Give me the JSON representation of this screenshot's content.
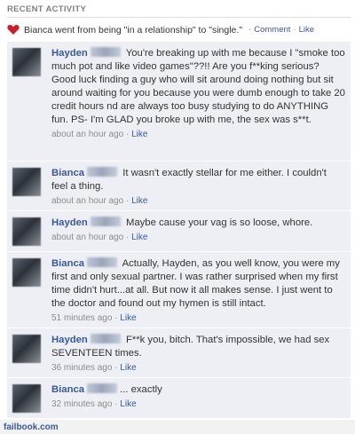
{
  "header": {
    "title": "RECENT ACTIVITY"
  },
  "story": {
    "text": "Bianca went from being \"in a relationship\" to \"single.\"",
    "comment_link": "Comment",
    "like_link": "Like",
    "separator": "·"
  },
  "comments": [
    {
      "author": "Hayden",
      "text": "You're breaking up with me because I \"smoke too much pot and like video games\"??!! Are you f**king serious? Good luck finding a guy who will sit around doing nothing but sit around waiting for you because you were dumb enough to take 20 credit hours nd are always too busy studying to do ANYTHING fun. PS- I'm GLAD you broke up with me, the sex was s**t.",
      "time": "about an hour ago",
      "like": "Like"
    },
    {
      "author": "Bianca",
      "text": "It wasn't exactly stellar for me either. I couldn't feel a thing.",
      "time": "about an hour ago",
      "like": "Like"
    },
    {
      "author": "Hayden",
      "text": "Maybe cause your vag is so loose, whore.",
      "time": "about an hour ago",
      "like": "Like"
    },
    {
      "author": "Bianca",
      "text": "Actually, Hayden, as you well know, you were my first and only sexual partner. I was rather surprised when my first time didn't hurt...at all. But now it all makes sense. I just went to the doctor and found out my hymen is still intact.",
      "time": "51 minutes ago",
      "like": "Like"
    },
    {
      "author": "Hayden",
      "text": "F**k you, bitch. That's impossible, we had sex SEVENTEEN times.",
      "time": "36 minutes ago",
      "like": "Like"
    },
    {
      "author": "Bianca",
      "text": "... exactly",
      "time": "32 minutes ago",
      "like": "Like"
    }
  ],
  "footer": {
    "watermark": "failbook.com"
  },
  "colors": {
    "link": "#3b5998",
    "comment_bg": "#edeff4",
    "heart": "#c9202a"
  }
}
